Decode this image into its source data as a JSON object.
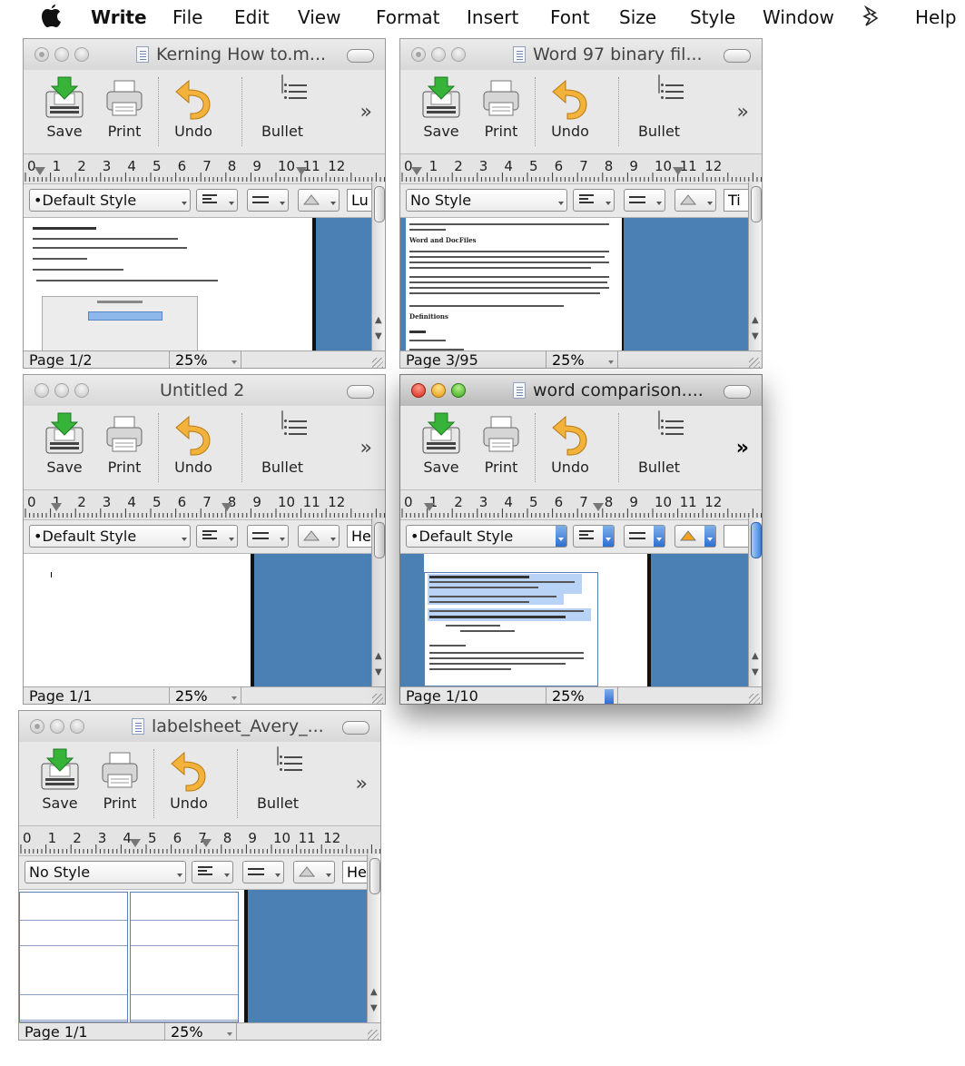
{
  "menubar": {
    "apple": "",
    "items": [
      "Write",
      "File",
      "Edit",
      "View",
      "Format",
      "Insert",
      "Font",
      "Size",
      "Style",
      "Window",
      "Help"
    ]
  },
  "toolbar": {
    "save": "Save",
    "print": "Print",
    "undo": "Undo",
    "bullet": "Bullet",
    "more": "»"
  },
  "ruler_numbers": [
    "0",
    "1",
    "2",
    "3",
    "4",
    "5",
    "6",
    "7",
    "8",
    "9",
    "10",
    "11",
    "12"
  ],
  "windows": [
    {
      "id": "w1",
      "title": "Kerning How to.m...",
      "state": "inactive",
      "style": "•Default Style",
      "font": "Lu",
      "page": "Page 1/2",
      "zoom": "25%"
    },
    {
      "id": "w2",
      "title": "Word 97 binary fil...",
      "state": "inactive",
      "style": "No Style",
      "font": "Ti",
      "page": "Page 3/95",
      "zoom": "25%",
      "doc": {
        "heading1": "Word and DocFiles",
        "heading2": "Definitions"
      }
    },
    {
      "id": "w3",
      "title": "Untitled 2",
      "state": "inactive",
      "style": "•Default Style",
      "font": "He",
      "page": "Page 1/1",
      "zoom": "25%"
    },
    {
      "id": "w4",
      "title": "word comparison....",
      "state": "active",
      "style": "•Default Style",
      "font": "",
      "page": "Page 1/10",
      "zoom": "25%"
    },
    {
      "id": "w5",
      "title": "labelsheet_Avery_...",
      "state": "inactive",
      "style": "No Style",
      "font": "He",
      "page": "Page 1/1",
      "zoom": "25%"
    }
  ],
  "colors": {
    "pasteboard": "#4a80b3",
    "active_accent": "#2e6fd0",
    "close": "#d4271a",
    "minimize": "#e39a12",
    "zoom": "#3aa41c"
  }
}
